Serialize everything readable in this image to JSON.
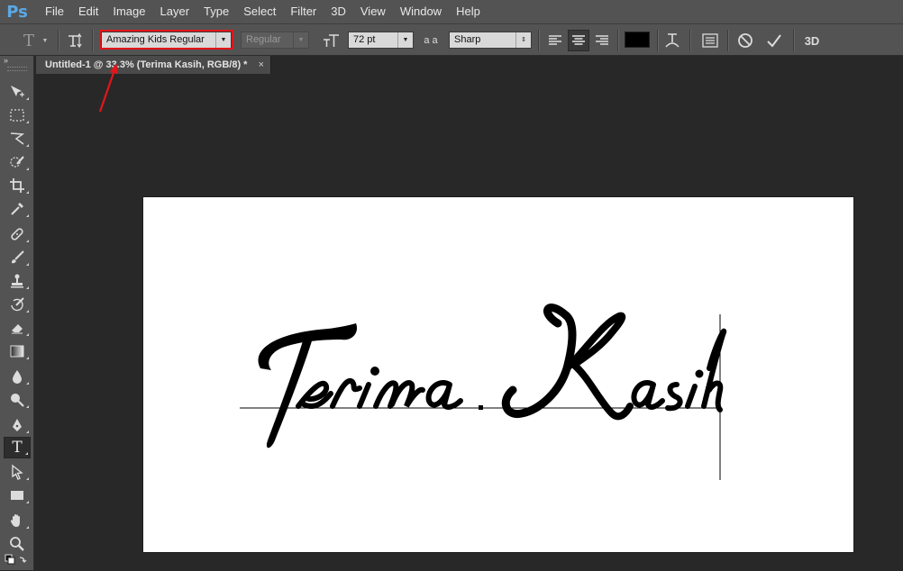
{
  "app": {
    "logo": "Ps"
  },
  "menu": [
    "File",
    "Edit",
    "Image",
    "Layer",
    "Type",
    "Select",
    "Filter",
    "3D",
    "View",
    "Window",
    "Help"
  ],
  "options": {
    "font_family": "Amazing Kids Regular",
    "font_style": "Regular",
    "font_size": "72 pt",
    "antialias_icon_text": "a a",
    "antialias": "Sharp",
    "text_color": "#000000",
    "threed_label": "3D"
  },
  "document": {
    "tab_title": "Untitled-1 @ 33.3% (Terima Kasih, RGB/8) *",
    "close_glyph": "×",
    "text": "Terima Kasih"
  },
  "toolbox": {
    "collapse": "»"
  },
  "colors": {
    "accent": "#e3151a",
    "canvas": "#ffffff",
    "workspace": "#282828",
    "panel": "#535353"
  }
}
